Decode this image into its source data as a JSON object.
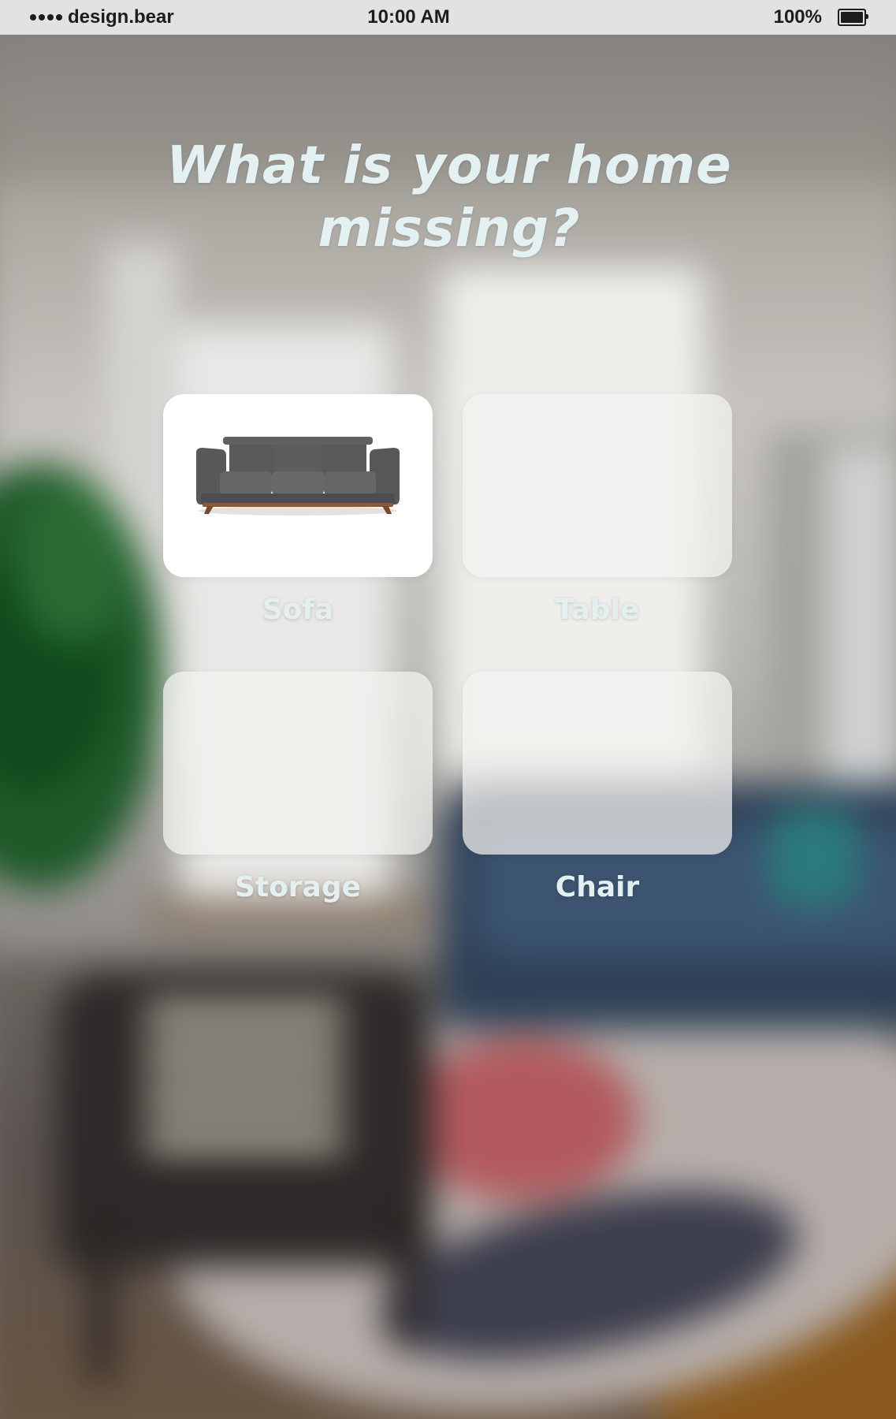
{
  "status_bar": {
    "carrier": "design.bear",
    "time": "10:00 AM",
    "battery": "100%"
  },
  "page": {
    "title": "What is your home missing?"
  },
  "options": [
    {
      "label": "Sofa",
      "selected": true,
      "icon": "sofa-icon"
    },
    {
      "label": "Table",
      "selected": false
    },
    {
      "label": "Storage",
      "selected": false
    },
    {
      "label": "Chair",
      "selected": false
    }
  ],
  "colors": {
    "title": "#e3f1f2",
    "label": "#e4eff0",
    "status_bar_bg": "#e2e2e2",
    "card_selected_bg": "#ffffff",
    "card_bg": "#f4f3f0"
  }
}
